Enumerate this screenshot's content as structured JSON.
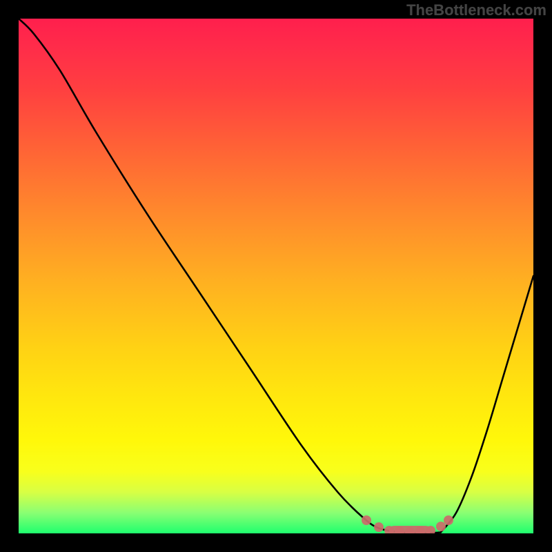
{
  "watermark": "TheBottleneck.com",
  "chart_data": {
    "type": "line",
    "title": "",
    "xlabel": "",
    "ylabel": "",
    "xlim": [
      0,
      100
    ],
    "ylim": [
      0,
      100
    ],
    "left_curve": {
      "name": "descending-curve",
      "points": [
        {
          "x": 0.0,
          "y": 100.0
        },
        {
          "x": 3.0,
          "y": 97.0
        },
        {
          "x": 8.0,
          "y": 90.0
        },
        {
          "x": 15.0,
          "y": 78.0
        },
        {
          "x": 25.0,
          "y": 62.0
        },
        {
          "x": 35.0,
          "y": 47.0
        },
        {
          "x": 45.0,
          "y": 32.0
        },
        {
          "x": 55.0,
          "y": 17.0
        },
        {
          "x": 62.0,
          "y": 8.0
        },
        {
          "x": 67.0,
          "y": 3.0
        },
        {
          "x": 70.0,
          "y": 1.0
        },
        {
          "x": 74.0,
          "y": 0.2
        }
      ]
    },
    "right_curve": {
      "name": "ascending-curve",
      "points": [
        {
          "x": 82.0,
          "y": 0.2
        },
        {
          "x": 85.0,
          "y": 4.0
        },
        {
          "x": 88.0,
          "y": 11.0
        },
        {
          "x": 91.0,
          "y": 20.0
        },
        {
          "x": 94.0,
          "y": 30.0
        },
        {
          "x": 97.0,
          "y": 40.0
        },
        {
          "x": 100.0,
          "y": 50.0
        }
      ]
    },
    "highlight_points": {
      "name": "bottleneck-segment",
      "color": "#cc6a6a",
      "points": [
        {
          "x": 67.5,
          "y": 2.6
        },
        {
          "x": 70.0,
          "y": 1.2
        },
        {
          "x": 72.0,
          "y": 0.6
        },
        {
          "x": 74.0,
          "y": 0.4
        },
        {
          "x": 76.0,
          "y": 0.3
        },
        {
          "x": 78.0,
          "y": 0.4
        },
        {
          "x": 80.0,
          "y": 0.6
        },
        {
          "x": 82.0,
          "y": 1.4
        },
        {
          "x": 83.5,
          "y": 2.6
        }
      ]
    }
  },
  "colors": {
    "background": "#000000",
    "curve": "#000000",
    "highlight": "#cc6a6a",
    "watermark": "#444444"
  }
}
